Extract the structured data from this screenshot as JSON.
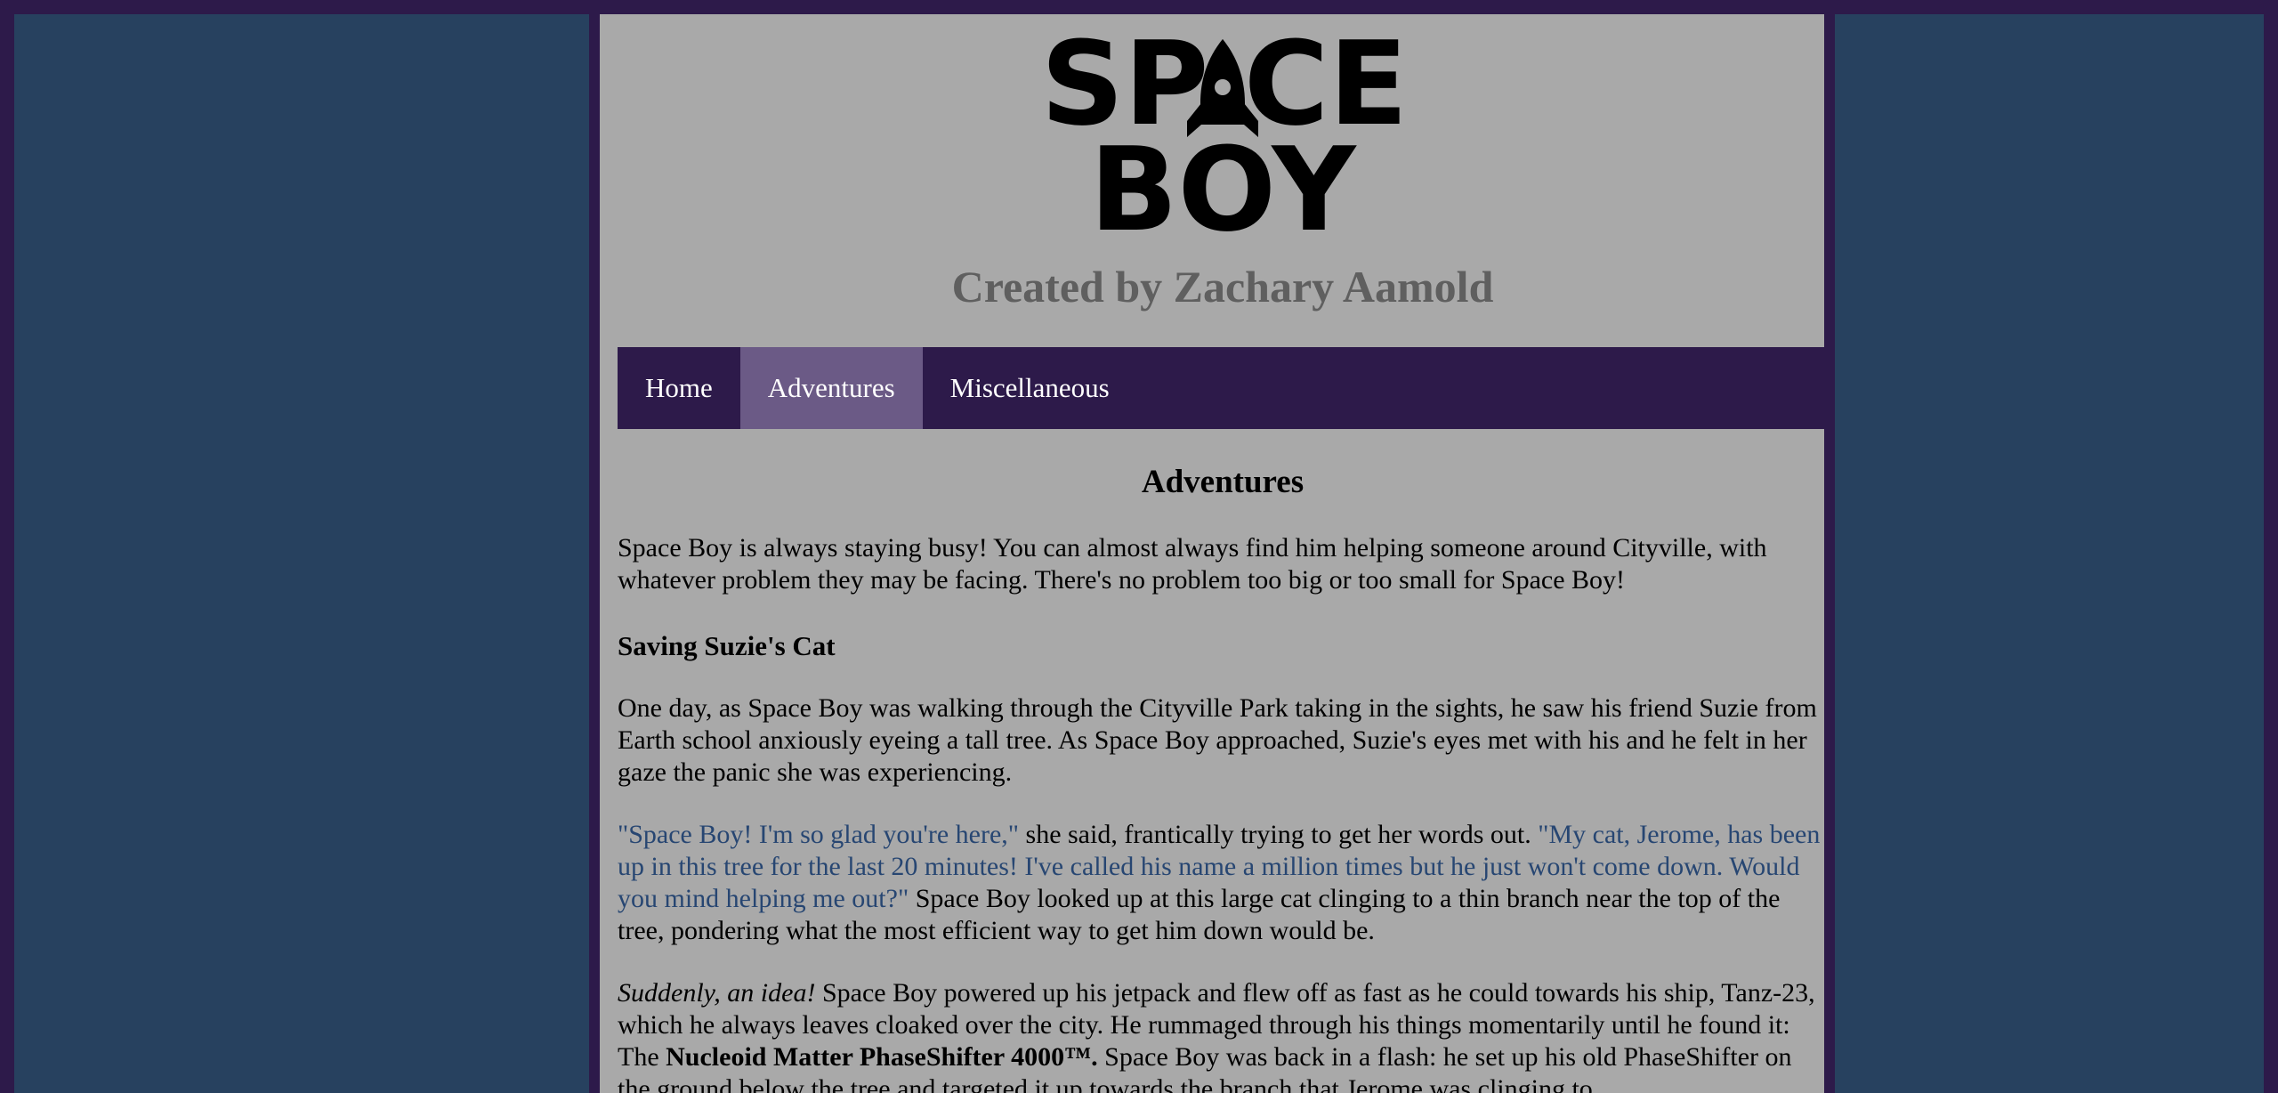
{
  "logo": {
    "line1": "SPACE",
    "line2": "BOY",
    "icon": "rocket-icon"
  },
  "credit": "Created by Zachary Aamold",
  "nav": {
    "items": [
      {
        "label": "Home",
        "active": false
      },
      {
        "label": "Adventures",
        "active": true
      },
      {
        "label": "Miscellaneous",
        "active": false
      }
    ]
  },
  "main": {
    "title": "Adventures",
    "intro": "Space Boy is always staying busy! You can almost always find him helping someone around Cityville, with whatever problem they may be facing. There's no problem too big or too small for Space Boy!",
    "story_title": "Saving Suzie's Cat",
    "p1": "One day, as Space Boy was walking through the Cityville Park taking in the sights, he saw his friend Suzie from Earth school anxiously eyeing a tall tree. As Space Boy approached, Suzie's eyes met with his and he felt in her gaze the panic she was experiencing.",
    "p2": {
      "q1": "\"Space Boy! I'm so glad you're here,\"",
      "t1": " she said, frantically trying to get her words out. ",
      "q2": "\"My cat, Jerome, has been up in this tree for the last 20 minutes! I've called his name a million times but he just won't come down. Would you mind helping me out?\"",
      "t2": " Space Boy looked up at this large cat clinging to a thin branch near the top of the tree, pondering what the most efficient way to get him down would be."
    },
    "p3": {
      "em": "Suddenly, an idea!",
      "t1": " Space Boy powered up his jetpack and flew off as fast as he could towards his ship, Tanz-23, which he always leaves cloaked over the city. He rummaged through his things momentarily until he found it: The ",
      "strong": "Nucleoid Matter PhaseShifter 4000™.",
      "t2": " Space Boy was back in a flash: he set up his old PhaseShifter on the ground below the tree and targeted it up towards the branch that Jerome was clinging to."
    }
  },
  "colors": {
    "frame": "#2d1a4a",
    "side": "#27415f",
    "content_bg": "#a9a9a9",
    "nav_bg": "#2d1a4a",
    "nav_active": "#6b5a86",
    "quote": "#274672",
    "credit": "#5f5f5f"
  }
}
